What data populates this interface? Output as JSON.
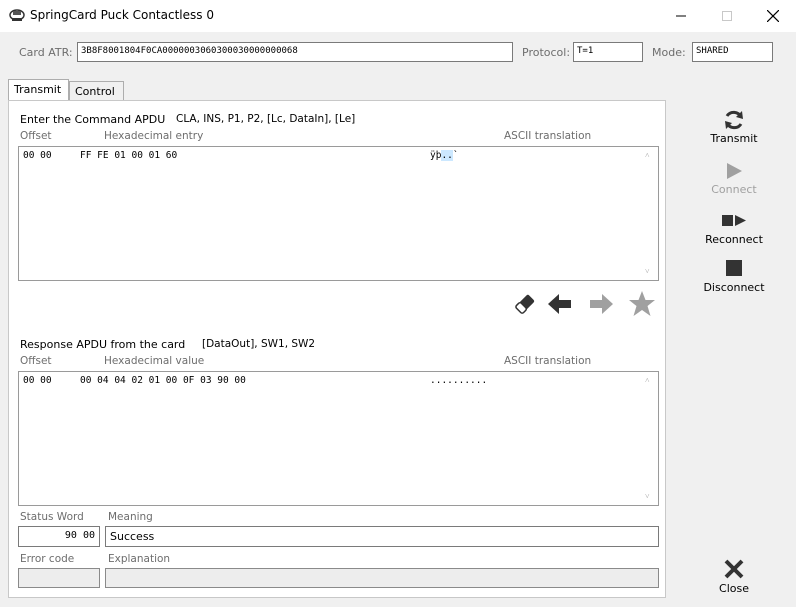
{
  "window": {
    "title": "SpringCard Puck Contactless 0",
    "icon": "card-reader-icon",
    "controls": [
      "minimize-icon",
      "maximize-icon",
      "close-icon"
    ]
  },
  "header": {
    "atr_label": "Card ATR:",
    "atr_value": "3B8F8001804F0CA0000003060300030000000068",
    "protocol_label": "Protocol:",
    "protocol_value": "T=1",
    "mode_label": "Mode:",
    "mode_value": "SHARED"
  },
  "tabs": [
    {
      "label": "Transmit",
      "active": true
    },
    {
      "label": "Control",
      "active": false
    }
  ],
  "command": {
    "title": "Enter the Command APDU",
    "format": "CLA, INS, P1, P2, [Lc, DataIn], [Le]",
    "col_offset": "Offset",
    "col_hex": "Hexadecimal entry",
    "col_ascii": "ASCII translation",
    "offset": "00 00",
    "hex": "FF FE 01 00 01 60",
    "ascii_pre": "ÿþ",
    "ascii_sel": "..",
    "ascii_post": "`"
  },
  "toolbar_icons": [
    "eraser-icon",
    "arrow-left-icon",
    "arrow-right-icon",
    "star-icon"
  ],
  "response": {
    "title": "Response APDU from the card",
    "format": "[DataOut], SW1, SW2",
    "col_offset": "Offset",
    "col_hex": "Hexadecimal value",
    "col_ascii": "ASCII translation",
    "offset": "00 00",
    "hex": "00 04 04 02 01 00 0F 03 90 00",
    "ascii": ".........."
  },
  "status": {
    "sw_label": "Status Word",
    "sw_value": "90 00",
    "meaning_label": "Meaning",
    "meaning_value": "Success",
    "error_label": "Error code",
    "error_value": "",
    "explanation_label": "Explanation",
    "explanation_value": ""
  },
  "sidebar": {
    "transmit": "Transmit",
    "connect": "Connect",
    "reconnect": "Reconnect",
    "disconnect": "Disconnect",
    "close": "Close"
  },
  "colors": {
    "selection": "#cce8ff",
    "icon_dark": "#333333",
    "icon_disabled": "#a0a0a0"
  }
}
